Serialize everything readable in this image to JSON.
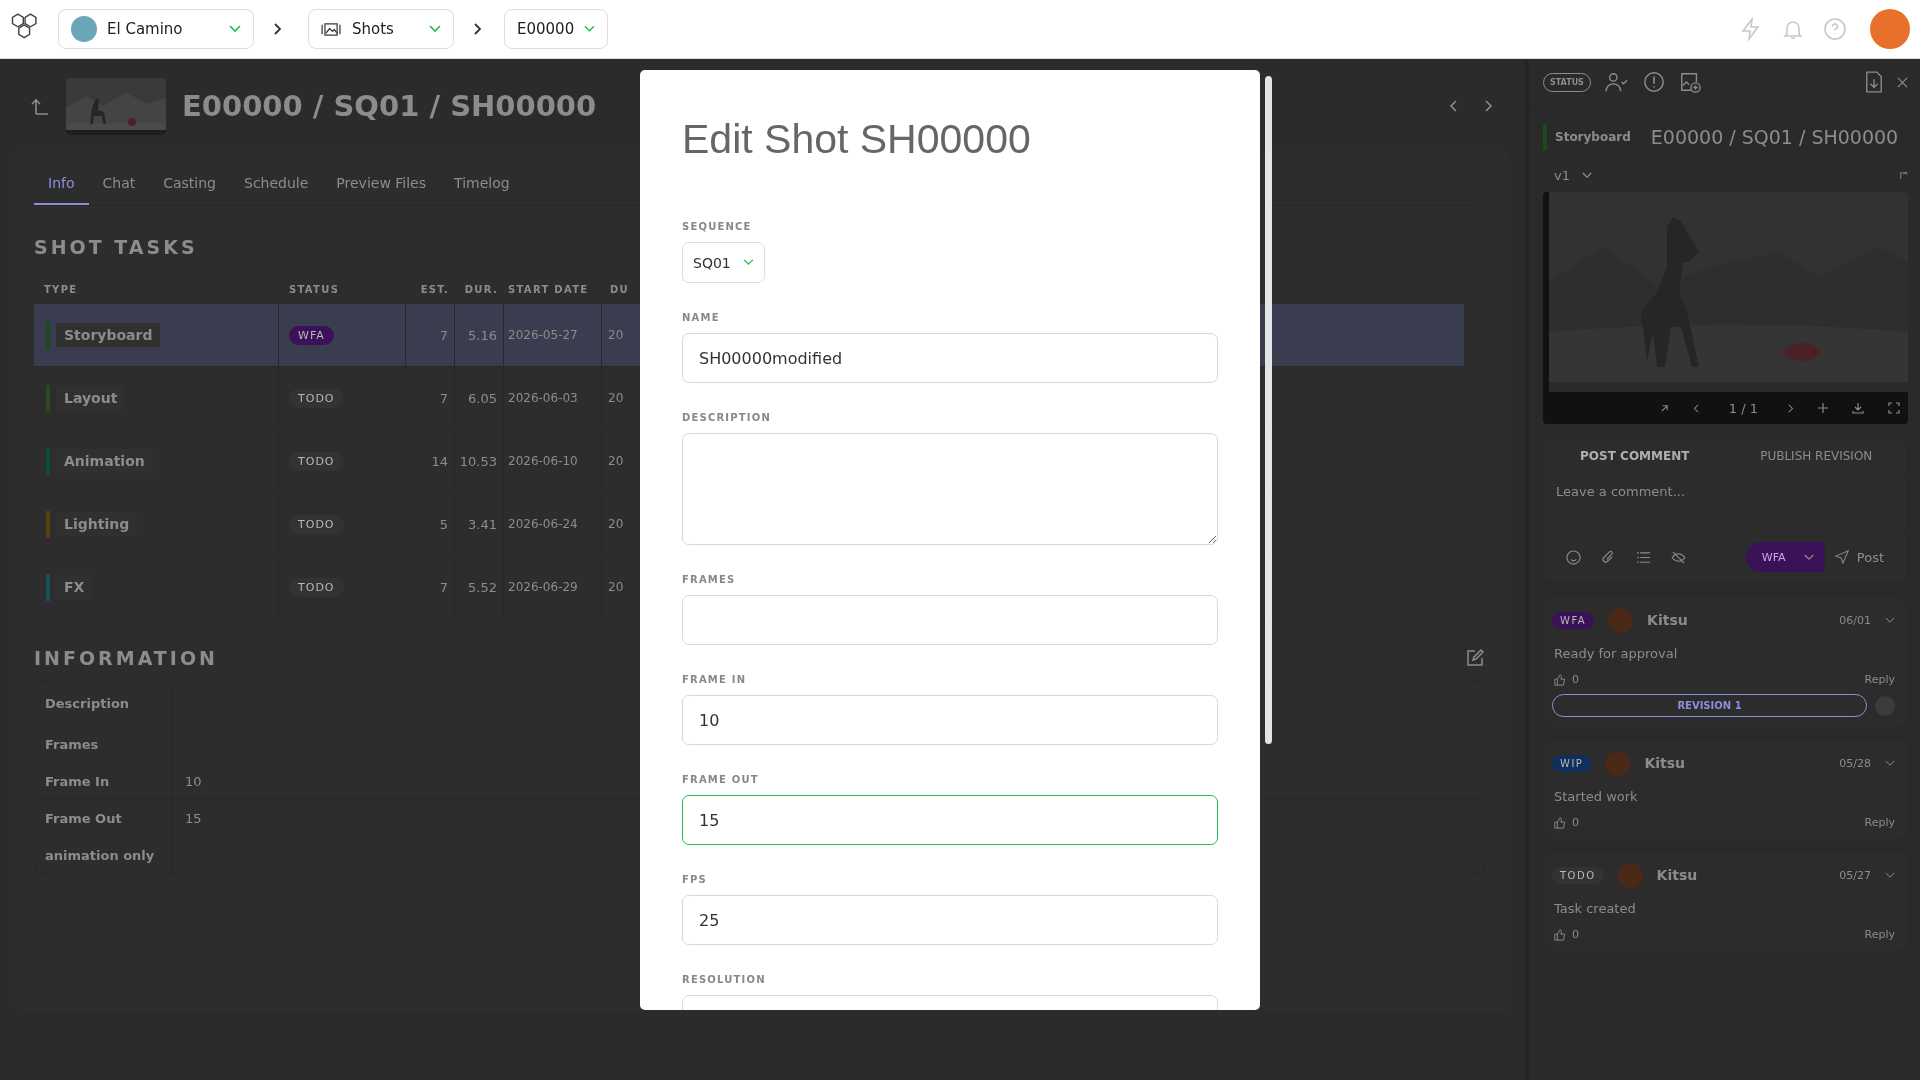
{
  "top_bar": {
    "production": "El Camino",
    "section": "Shots",
    "episode": "E00000"
  },
  "shot_page": {
    "title": "E00000 / SQ01 / SH00000",
    "tabs": [
      {
        "label": "Info",
        "selected": true
      },
      {
        "label": "Chat",
        "selected": false
      },
      {
        "label": "Casting",
        "selected": false
      },
      {
        "label": "Schedule",
        "selected": false
      },
      {
        "label": "Preview Files",
        "selected": false
      },
      {
        "label": "Timelog",
        "selected": false
      }
    ],
    "tasks_heading": "SHOT TASKS",
    "task_columns": [
      "TYPE",
      "STATUS",
      "EST.",
      "DUR.",
      "START DATE",
      "DU"
    ],
    "tasks": [
      {
        "type": "Storyboard",
        "color": "#1d4a1d",
        "status": {
          "label": "WFA",
          "color": "#3b1258"
        },
        "est": "7",
        "dur": "5.16",
        "start_date": "2026-05-27",
        "due": "20",
        "selected": true
      },
      {
        "type": "Layout",
        "color": "#2c4a1a",
        "status": {
          "label": "TODO",
          "color": "#333333"
        },
        "est": "7",
        "dur": "6.05",
        "start_date": "2026-06-03",
        "due": "20",
        "selected": false
      },
      {
        "type": "Animation",
        "color": "#0f4a40",
        "status": {
          "label": "TODO",
          "color": "#333333"
        },
        "est": "14",
        "dur": "10.53",
        "start_date": "2026-06-10",
        "due": "20",
        "selected": false
      },
      {
        "type": "Lighting",
        "color": "#5a3f10",
        "status": {
          "label": "TODO",
          "color": "#333333"
        },
        "est": "5",
        "dur": "3.41",
        "start_date": "2026-06-24",
        "due": "20",
        "selected": false
      },
      {
        "type": "FX",
        "color": "#17505c",
        "status": {
          "label": "TODO",
          "color": "#333333"
        },
        "est": "7",
        "dur": "5.52",
        "start_date": "2026-06-29",
        "due": "20",
        "selected": false
      }
    ],
    "info_heading": "INFORMATION",
    "info": [
      {
        "label": "Description"
      },
      {
        "label": "Frames"
      },
      {
        "label": "Frame In",
        "value": "10"
      },
      {
        "label": "Frame Out",
        "value": "15"
      },
      {
        "label": "animation only"
      }
    ]
  },
  "side_panel": {
    "status_button": "STATUS",
    "task_type": {
      "label": "Storyboard",
      "color": "#1d4a1d"
    },
    "title": "E00000 / SQ01 / SH00000",
    "version": "v1",
    "counter": "1 / 1",
    "comment_tabs": [
      {
        "label": "POST COMMENT",
        "selected": true
      },
      {
        "label": "PUBLISH REVISION",
        "selected": false
      }
    ],
    "comment_placeholder": "Leave a comment...",
    "post_status": {
      "label": "WFA",
      "color": "#3b1258"
    },
    "post_button": "Post",
    "comments": [
      {
        "status": {
          "label": "WFA",
          "color": "#3b1258"
        },
        "author": "Kitsu",
        "date": "06/01",
        "text": "Ready for approval",
        "likes": "0",
        "reply": "Reply",
        "revision": "REVISION 1"
      },
      {
        "status": {
          "label": "WIP",
          "color": "#102f5c"
        },
        "author": "Kitsu",
        "date": "05/28",
        "text": "Started work",
        "likes": "0",
        "reply": "Reply"
      },
      {
        "status": {
          "label": "TODO",
          "color": "#333333"
        },
        "author": "Kitsu",
        "date": "05/27",
        "text": "Task created",
        "likes": "0",
        "reply": "Reply"
      }
    ]
  },
  "dialog": {
    "title": "Edit Shot SH00000",
    "fields": [
      {
        "kind": "select",
        "label": "SEQUENCE",
        "value": "SQ01",
        "focused": false
      },
      {
        "kind": "text",
        "label": "NAME",
        "value": "SH00000modified",
        "focused": false
      },
      {
        "kind": "textarea",
        "label": "DESCRIPTION",
        "focused": false
      },
      {
        "kind": "text",
        "label": "FRAMES",
        "focused": false
      },
      {
        "kind": "text",
        "label": "FRAME IN",
        "value": "10",
        "focused": false
      },
      {
        "kind": "text",
        "label": "FRAME OUT",
        "value": "15",
        "focused": true
      },
      {
        "kind": "text",
        "label": "FPS",
        "value": "25",
        "focused": false
      },
      {
        "kind": "text",
        "label": "RESOLUTION",
        "focused": false
      }
    ]
  }
}
